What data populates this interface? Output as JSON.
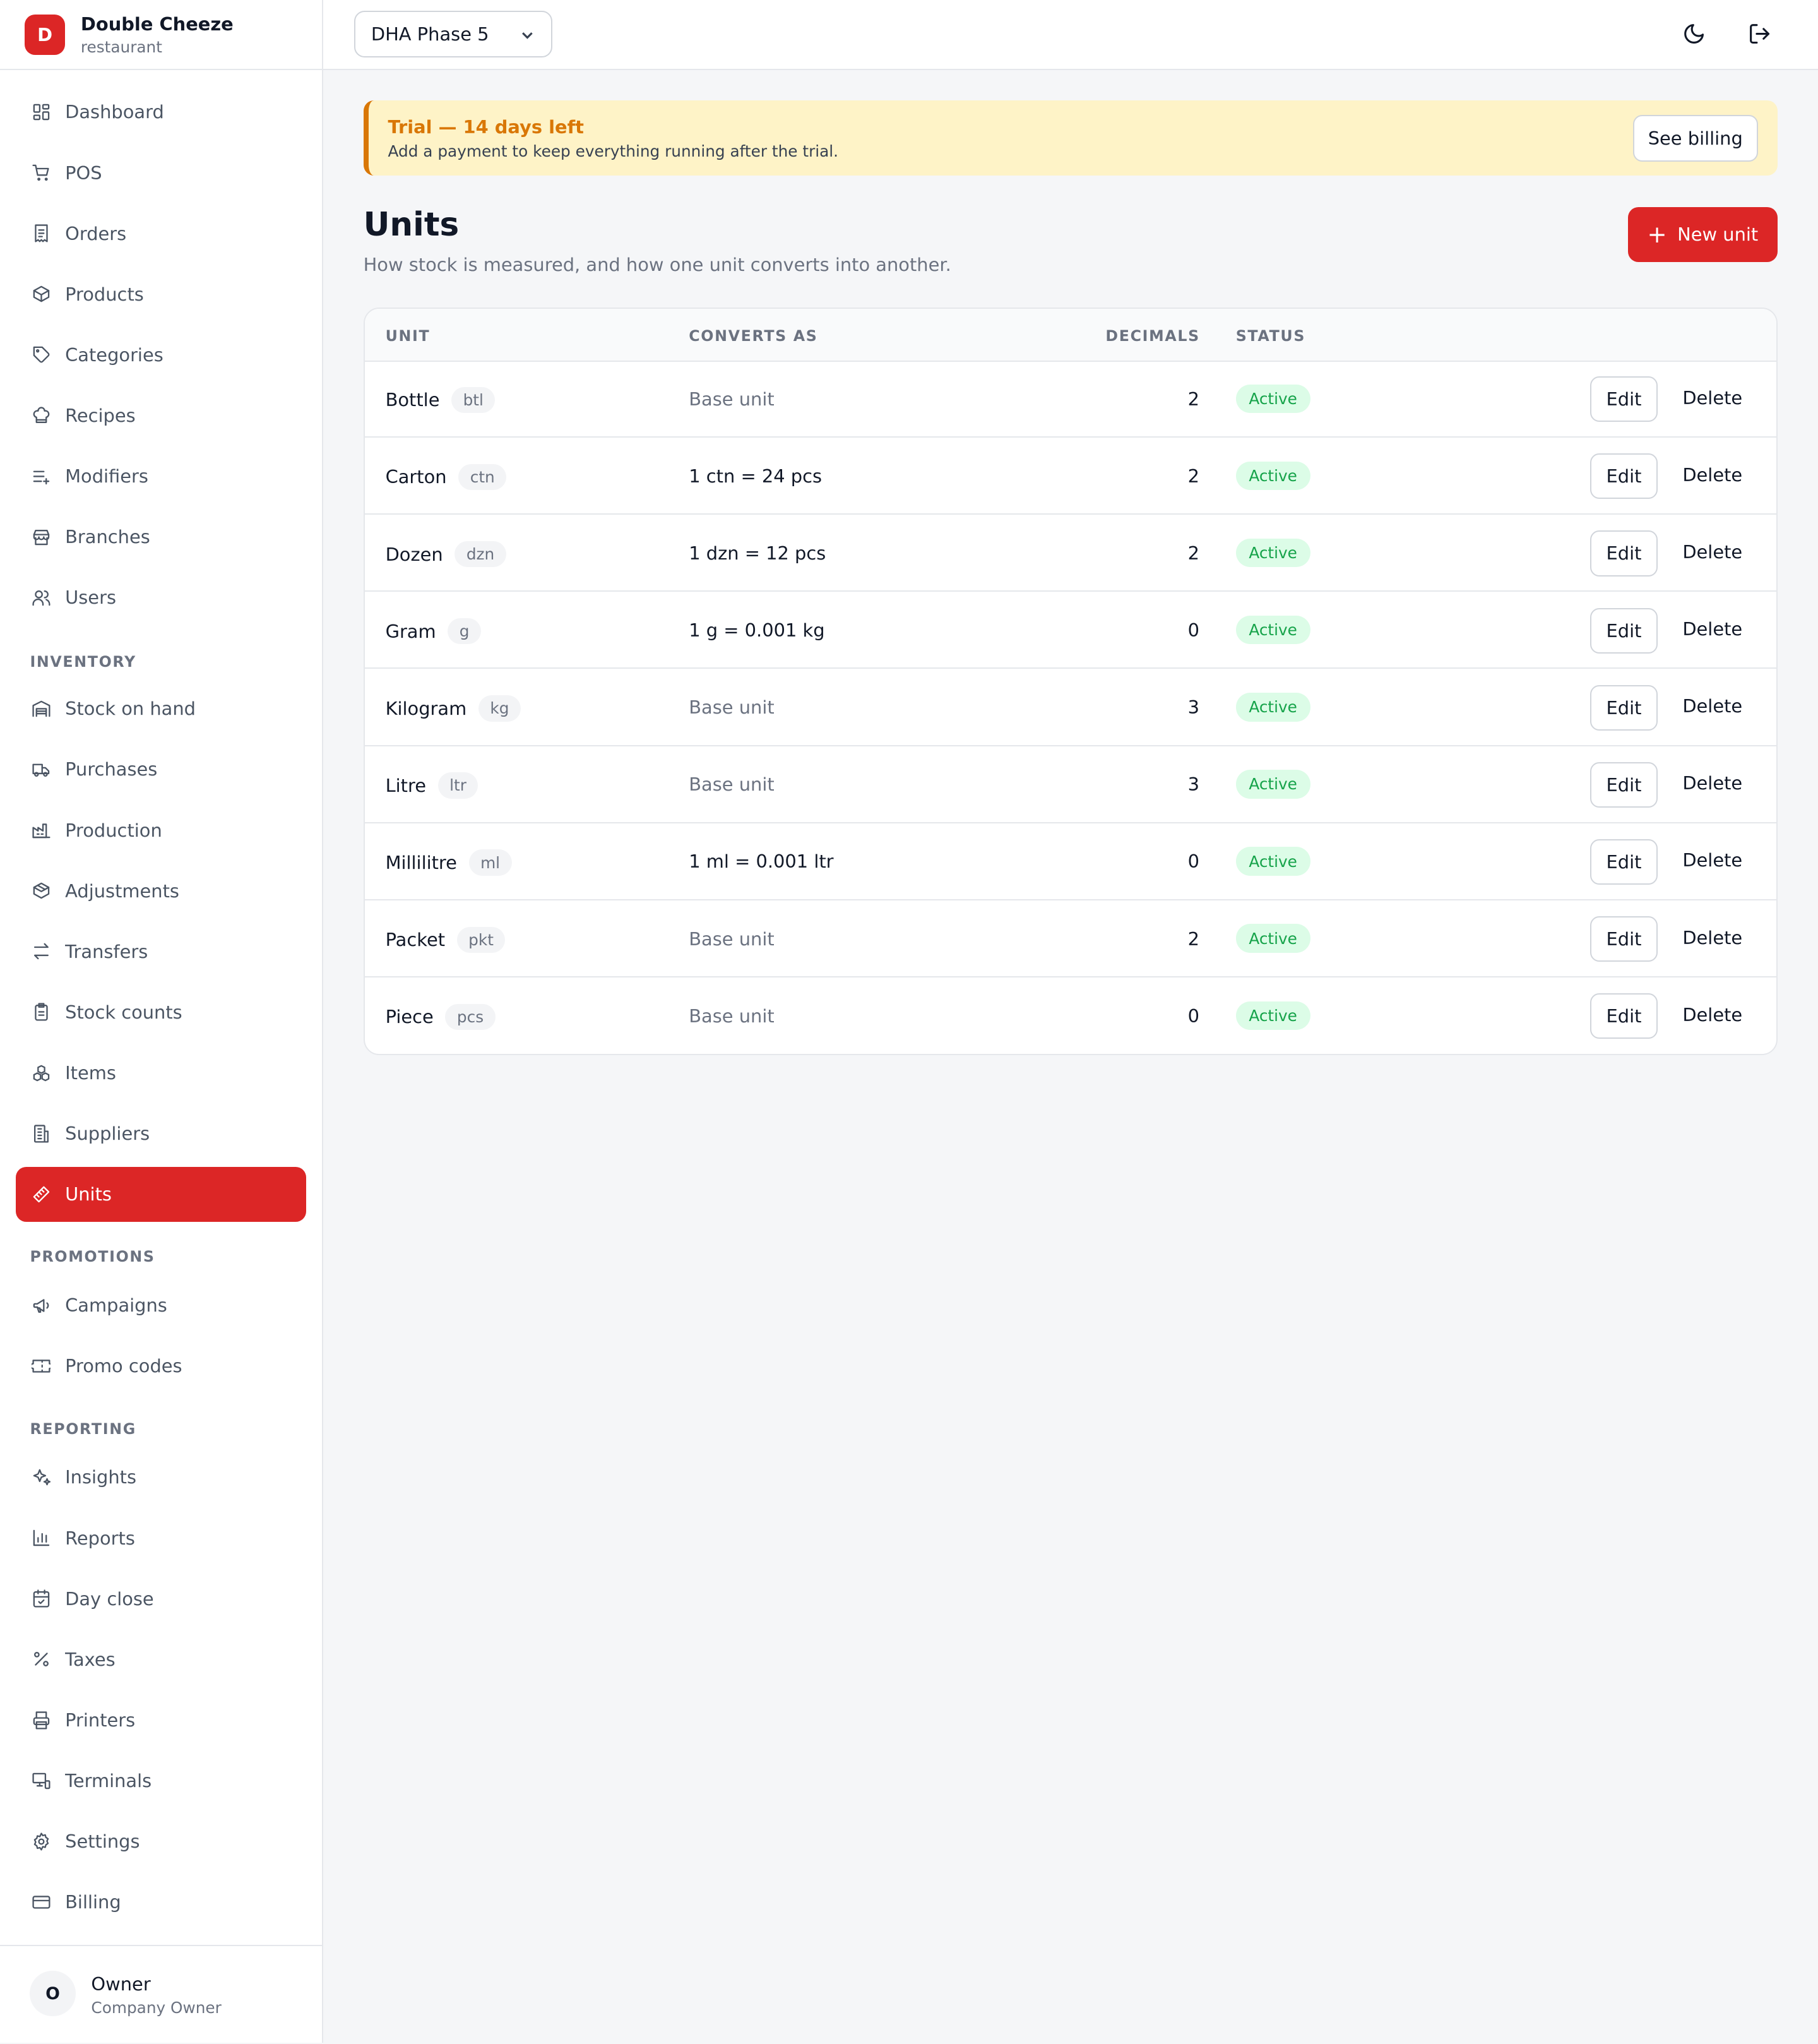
{
  "brand": {
    "initial": "D",
    "name": "Double Cheeze",
    "subtitle": "restaurant"
  },
  "nav": {
    "main": [
      {
        "label": "Dashboard",
        "icon": "dashboard-icon"
      },
      {
        "label": "POS",
        "icon": "cart-icon"
      },
      {
        "label": "Orders",
        "icon": "receipt-icon"
      },
      {
        "label": "Products",
        "icon": "box-icon"
      },
      {
        "label": "Categories",
        "icon": "tag-icon"
      },
      {
        "label": "Recipes",
        "icon": "chef-hat-icon"
      },
      {
        "label": "Modifiers",
        "icon": "list-plus-icon"
      },
      {
        "label": "Branches",
        "icon": "store-icon"
      },
      {
        "label": "Users",
        "icon": "users-icon"
      }
    ],
    "inventory_label": "INVENTORY",
    "inventory": [
      {
        "label": "Stock on hand",
        "icon": "warehouse-icon"
      },
      {
        "label": "Purchases",
        "icon": "truck-icon"
      },
      {
        "label": "Production",
        "icon": "factory-icon"
      },
      {
        "label": "Adjustments",
        "icon": "package-icon"
      },
      {
        "label": "Transfers",
        "icon": "transfer-icon"
      },
      {
        "label": "Stock counts",
        "icon": "clipboard-icon"
      },
      {
        "label": "Items",
        "icon": "boxes-icon"
      },
      {
        "label": "Suppliers",
        "icon": "building-icon"
      },
      {
        "label": "Units",
        "icon": "ruler-icon",
        "active": true
      }
    ],
    "promotions_label": "PROMOTIONS",
    "promotions": [
      {
        "label": "Campaigns",
        "icon": "megaphone-icon"
      },
      {
        "label": "Promo codes",
        "icon": "ticket-icon"
      }
    ],
    "reporting_label": "REPORTING",
    "reporting": [
      {
        "label": "Insights",
        "icon": "sparkles-icon"
      },
      {
        "label": "Reports",
        "icon": "bar-chart-icon"
      },
      {
        "label": "Day close",
        "icon": "calendar-check-icon"
      },
      {
        "label": "Taxes",
        "icon": "percent-icon"
      },
      {
        "label": "Printers",
        "icon": "printer-icon"
      },
      {
        "label": "Terminals",
        "icon": "monitor-icon"
      },
      {
        "label": "Settings",
        "icon": "gear-icon"
      },
      {
        "label": "Billing",
        "icon": "credit-card-icon"
      }
    ]
  },
  "user": {
    "initial": "O",
    "name": "Owner",
    "role": "Company Owner"
  },
  "topbar": {
    "branch": "DHA Phase 5"
  },
  "banner": {
    "title": "Trial — 14 days left",
    "text": "Add a payment to keep everything running after the trial.",
    "button": "See billing"
  },
  "page": {
    "title": "Units",
    "subtitle": "How stock is measured, and how one unit converts into another.",
    "new_button": "New unit"
  },
  "table": {
    "headers": {
      "unit": "UNIT",
      "converts": "CONVERTS AS",
      "decimals": "DECIMALS",
      "status": "STATUS"
    },
    "edit_label": "Edit",
    "delete_label": "Delete",
    "rows": [
      {
        "name": "Bottle",
        "abbr": "btl",
        "converts": "Base unit",
        "base": true,
        "decimals": "2",
        "status": "Active"
      },
      {
        "name": "Carton",
        "abbr": "ctn",
        "converts": "1 ctn = 24 pcs",
        "base": false,
        "decimals": "2",
        "status": "Active"
      },
      {
        "name": "Dozen",
        "abbr": "dzn",
        "converts": "1 dzn = 12 pcs",
        "base": false,
        "decimals": "2",
        "status": "Active"
      },
      {
        "name": "Gram",
        "abbr": "g",
        "converts": "1 g = 0.001 kg",
        "base": false,
        "decimals": "0",
        "status": "Active"
      },
      {
        "name": "Kilogram",
        "abbr": "kg",
        "converts": "Base unit",
        "base": true,
        "decimals": "3",
        "status": "Active"
      },
      {
        "name": "Litre",
        "abbr": "ltr",
        "converts": "Base unit",
        "base": true,
        "decimals": "3",
        "status": "Active"
      },
      {
        "name": "Millilitre",
        "abbr": "ml",
        "converts": "1 ml = 0.001 ltr",
        "base": false,
        "decimals": "0",
        "status": "Active"
      },
      {
        "name": "Packet",
        "abbr": "pkt",
        "converts": "Base unit",
        "base": true,
        "decimals": "2",
        "status": "Active"
      },
      {
        "name": "Piece",
        "abbr": "pcs",
        "converts": "Base unit",
        "base": true,
        "decimals": "0",
        "status": "Active"
      }
    ]
  },
  "colors": {
    "accent": "#dc2626",
    "warning": "#d97706",
    "success": "#16a34a"
  }
}
